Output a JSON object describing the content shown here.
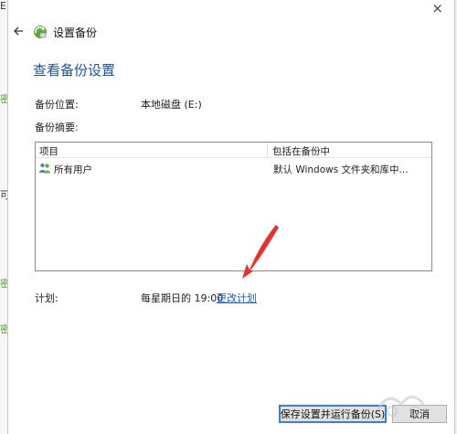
{
  "window": {
    "title": "设置备份",
    "close_glyph": "×"
  },
  "page": {
    "heading": "查看备份设置"
  },
  "backup": {
    "location_label": "备份位置:",
    "location_value": "本地磁盘 (E:)",
    "summary_label": "备份摘要:",
    "schedule_label": "计划:",
    "schedule_value": "每星期日的 19:00",
    "change_schedule_link": "更改计划"
  },
  "summary_table": {
    "columns": [
      "项目",
      "包括在备份中"
    ],
    "rows": [
      {
        "item": "所有用户",
        "included": "默认 Windows 文件夹和库中..."
      }
    ]
  },
  "buttons": {
    "save_and_run": "保存设置并运行备份(S)",
    "cancel_partial": "取消"
  },
  "background": {
    "fragments": [
      "E",
      "密",
      "可",
      "密",
      "密"
    ]
  },
  "colors": {
    "heading": "#1a54a0",
    "link": "#1a5fc4",
    "annotation_arrow": "#e8312f",
    "primary_button_border": "#3c7fd6"
  },
  "icons": {
    "back": "back-arrow-icon",
    "app": "backup-restore-icon",
    "users": "users-icon",
    "close": "close-icon"
  }
}
